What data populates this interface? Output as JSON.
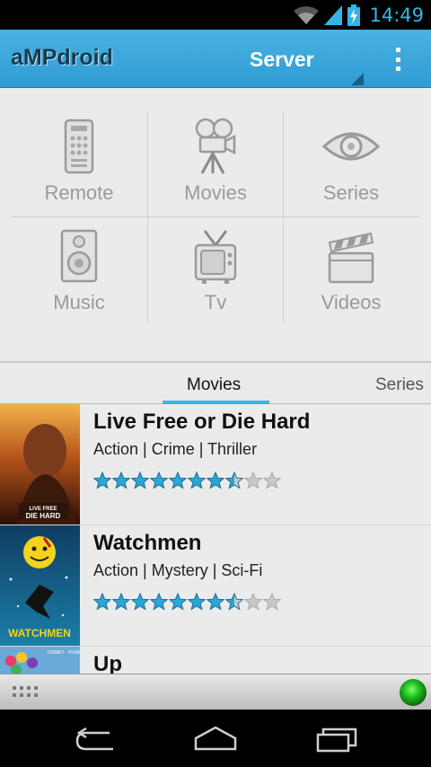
{
  "status_bar": {
    "time": "14:49"
  },
  "action_bar": {
    "app_title": "aMPdroid",
    "server_label": "Server"
  },
  "grid": {
    "tiles": [
      {
        "label": "Remote",
        "icon": "remote-icon"
      },
      {
        "label": "Movies",
        "icon": "movie-camera-icon"
      },
      {
        "label": "Series",
        "icon": "eye-icon"
      },
      {
        "label": "Music",
        "icon": "speaker-icon"
      },
      {
        "label": "Tv",
        "icon": "tv-icon"
      },
      {
        "label": "Videos",
        "icon": "clapperboard-icon"
      }
    ]
  },
  "tabs": {
    "movies_label": "Movies",
    "series_label": "Series",
    "selected": "Movies"
  },
  "movies": [
    {
      "title": "Live Free or Die Hard",
      "genres": "Action | Crime | Thriller",
      "rating": 7.5,
      "max_rating": 10,
      "poster_text": "LIVE FREE DIE HARD"
    },
    {
      "title": "Watchmen",
      "genres": "Action | Mystery | Sci-Fi",
      "rating": 7.5,
      "max_rating": 10,
      "poster_text": "WATCHMEN"
    },
    {
      "title": "Up",
      "genres": "",
      "rating": null,
      "max_rating": 10,
      "poster_text": "DISNEY PIXAR"
    }
  ],
  "colors": {
    "accent": "#33b5e5",
    "action_bar": "#39a7da",
    "star_filled": "#2aa6d7",
    "star_empty": "#c8c8c8",
    "status_led": "#1fc01f"
  }
}
